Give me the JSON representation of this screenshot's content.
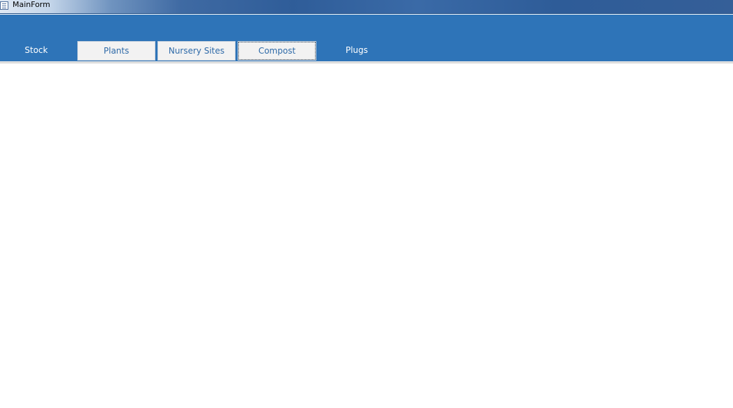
{
  "window": {
    "title": "MainForm",
    "icon": "form-icon"
  },
  "tabs": [
    {
      "label": "Stock",
      "style": "flat"
    },
    {
      "label": "Plants",
      "style": "boxed"
    },
    {
      "label": "Nursery Sites",
      "style": "boxed"
    },
    {
      "label": "Compost",
      "style": "boxed",
      "focused": true
    },
    {
      "label": "Plugs",
      "style": "flat"
    }
  ],
  "colors": {
    "header_band": "#2e74b8",
    "tab_text_boxed": "#2e6aa8",
    "tab_text_flat": "#ffffff",
    "tab_bg_boxed": "#f2f2f2"
  }
}
